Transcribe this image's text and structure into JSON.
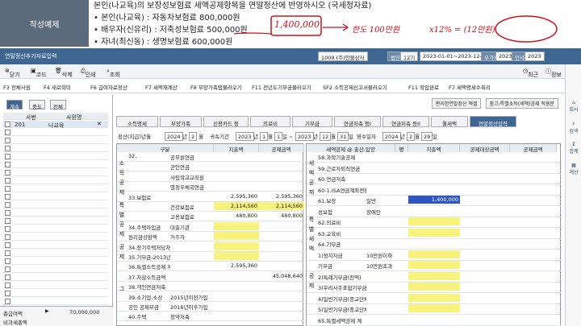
{
  "banner": {
    "tag": "작성예제",
    "line1": "본인(나교육)의 보장성보험료 세액공제항목을 연말정산에 반영하시오 (국세청자료)",
    "line2": "• 본인(나교육) : 자동차보험료 800,000원",
    "line3": "• 배우자(신유리) : 저축성보험료 500,000원",
    "line4": "• 자녀(최신동) : 생명보험료 600,000원"
  },
  "handwriting": {
    "a": "1,400,000",
    "b": "한도 100만원",
    "c": "x12% = (12만원)"
  },
  "window": {
    "title": "연말정산추가자료입력",
    "company_code": "1009",
    "company_name": "(주)만물상사",
    "period_label": "법인",
    "period_no": "12기",
    "period": "2023-01-01~2023-12-31",
    "tax_label": "부가세",
    "year1": "2023",
    "user_label": "인사",
    "year2": "2023"
  },
  "toolbar1": {
    "close": "닫기",
    "code": "코드",
    "delete": "삭제",
    "print": "인쇄",
    "query": "조회",
    "recent": "최근",
    "info": "정보"
  },
  "toolbar2": [
    "F3 전체사원",
    "F4 새로학미",
    "F6 급여자료정산",
    "F7 세액재계산",
    "F8 부양가족탭불러오기",
    "F11 전년도기부금불러오기",
    "SF2 소득공제신고서불러오기",
    "F11 작업완료",
    "F7 세액명세수취리"
  ],
  "side": [
    "회사",
    "검색",
    "합계",
    "계산"
  ],
  "left": {
    "tabs": [
      "계속",
      "중도",
      "전체"
    ],
    "col1": "사번",
    "col2": "사원명",
    "emp_code": "201",
    "emp_name": "나교육",
    "total_label": "총급여액",
    "total_value": "70,000,000",
    "tax_label": "비과세총액"
  },
  "main": {
    "linkbtns": [
      "편리한연말정산 엑셀",
      "참고:특별소득(세액)공제 적용분"
    ],
    "tabs": [
      "소득명세",
      "부양가족",
      "신용카드 등",
      "의료비",
      "기부금",
      "연금저축 등I",
      "연금저축 등II",
      "월세액",
      "연말정산입력"
    ],
    "period": {
      "label": "정산(지급)년월",
      "year": "2024",
      "month": "2",
      "recv_label": "귀속기간",
      "from_y": "2023",
      "from_m": "1",
      "from_d": "1",
      "to_y": "2023",
      "to_m": "12",
      "to_d": "31",
      "rcpt_label": "영수일자",
      "rcpt_y": "2024",
      "rcpt_m": "2",
      "rcpt_d": "29"
    },
    "lhdr": [
      "구분",
      "지출액",
      "공제금액"
    ],
    "lrows": [
      [
        "32.",
        "공무원연금",
        "",
        ""
      ],
      [
        "",
        "군인연금",
        "",
        ""
      ],
      [
        "",
        "사립학교교직원",
        "",
        ""
      ],
      [
        "",
        "별정우체국연금",
        "",
        ""
      ],
      [
        "33.보험료",
        "",
        "2,595,360",
        "2,595,360"
      ],
      [
        "",
        "건강보험료",
        "2,114,560",
        "2,114,560"
      ],
      [
        "",
        "고용보험료",
        "480,800",
        "480,800"
      ],
      [
        "34.주택차입금",
        "대출기관",
        "",
        ""
      ],
      [
        "원리금상환액",
        "거주자",
        "",
        ""
      ],
      [
        "34.장기주택저당차입금이자상",
        "",
        "",
        ""
      ],
      [
        "35.기부금-2013년이전이월분",
        "",
        "",
        ""
      ],
      [
        "36.특별소득공제 계",
        "",
        "2,595,360",
        ""
      ],
      [
        "37.차감소득금액",
        "",
        "",
        "45,048,640"
      ],
      [
        "38.개인연금저축",
        "",
        "",
        ""
      ],
      [
        "39.소기업.소상",
        "2015년이전가입",
        "",
        ""
      ],
      [
        "공인 공제부금",
        "2016년이후가입",
        "",
        ""
      ],
      [
        "40.주택",
        "청약저축",
        "",
        ""
      ]
    ],
    "rhdr": [
      "세액공제 @ 출산.입양",
      "명",
      "지출액",
      "공제대상금액",
      "공제금액"
    ],
    "rrows": [
      [
        "58.과학기술공제",
        "",
        "",
        ""
      ],
      [
        "59.근로자퇴직연금",
        "",
        "",
        ""
      ],
      [
        "60.연금저축",
        "",
        "",
        ""
      ],
      [
        "60-1.ISA연금계좌전환",
        "",
        "",
        ""
      ],
      [
        "61.보장",
        "일반",
        "1,400,000",
        ""
      ],
      [
        "성보험",
        "장애인",
        "",
        ""
      ],
      [
        "62.의료비",
        "",
        "",
        ""
      ],
      [
        "63.교육비",
        "",
        "",
        ""
      ],
      [
        "64.기부금",
        "",
        "",
        ""
      ],
      [
        "1)정치자금",
        "10만원이하",
        "",
        ""
      ],
      [
        "기부금",
        "10만원초과",
        "",
        ""
      ],
      [
        "2)특례기부금(전액)",
        "",
        "",
        ""
      ],
      [
        "3)우리사주조합기부금",
        "",
        "",
        ""
      ],
      [
        "4)일반기부금(종교단체외)",
        "",
        "",
        ""
      ],
      [
        "5)일반기부금(종교단체)",
        "",
        "",
        ""
      ],
      [
        "65.특별세액공제 계",
        "",
        "",
        ""
      ]
    ],
    "lside": [
      "소득공제",
      "특별공제",
      "공제",
      "그"
    ],
    "rside": [
      "세액공제",
      "특별세액",
      "공제"
    ]
  }
}
